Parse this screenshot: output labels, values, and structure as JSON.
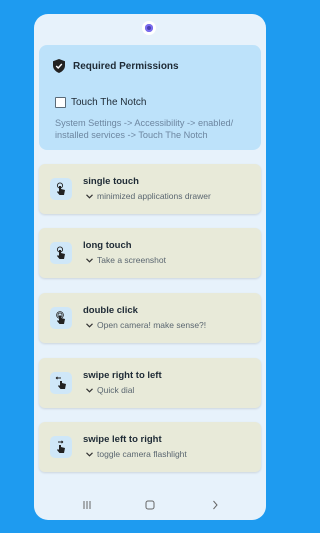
{
  "permissions": {
    "title": "Required Permissions",
    "checkbox_label": "Touch The Notch",
    "description": "System Settings -> Accessibility -> enabled/ installed services -> Touch The Notch"
  },
  "gestures": [
    {
      "title": "single touch",
      "action": "minimized applications drawer",
      "icon": "tap-icon"
    },
    {
      "title": "long touch",
      "action": "Take a screenshot",
      "icon": "long-press-icon"
    },
    {
      "title": "double click",
      "action": "Open camera! make sense?!",
      "icon": "double-tap-icon"
    },
    {
      "title": "swipe right to left",
      "action": "Quick dial",
      "icon": "swipe-left-icon"
    },
    {
      "title": "swipe left to right",
      "action": "toggle camera flashlight",
      "icon": "swipe-right-icon"
    }
  ],
  "icons": {
    "shield": "shield-icon",
    "chevron": "chevron-down-icon",
    "nav": [
      "recent-apps-icon",
      "home-icon",
      "back-icon"
    ]
  },
  "colors": {
    "background": "#1e9bf0",
    "permission_card": "#bde2fa",
    "gesture_card": "#e8ead9",
    "icon_tile": "#cfe7f8"
  }
}
